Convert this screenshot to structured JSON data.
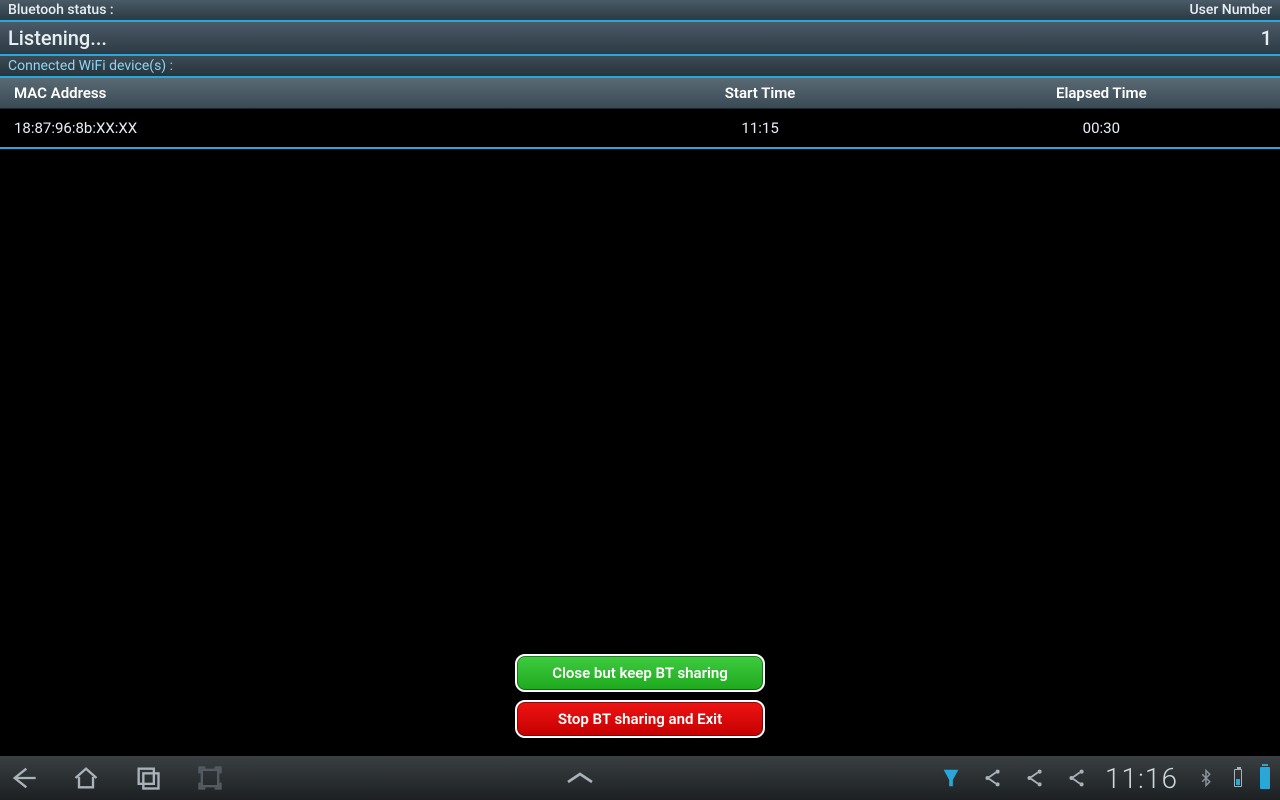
{
  "header": {
    "bluetooth_label": "Bluetooh status :",
    "user_label": "User Number",
    "status_value": "Listening...",
    "user_count": "1"
  },
  "wifi_section_label": "Connected WiFi device(s) :",
  "table": {
    "headers": {
      "mac": "MAC Address",
      "start": "Start Time",
      "elapsed": "Elapsed Time"
    },
    "rows": [
      {
        "mac": "18:87:96:8b:XX:XX",
        "start": "11:15",
        "elapsed": "00:30"
      }
    ]
  },
  "buttons": {
    "keep": "Close but keep BT sharing",
    "stop": "Stop BT sharing and Exit"
  },
  "system": {
    "clock": "11:16"
  }
}
